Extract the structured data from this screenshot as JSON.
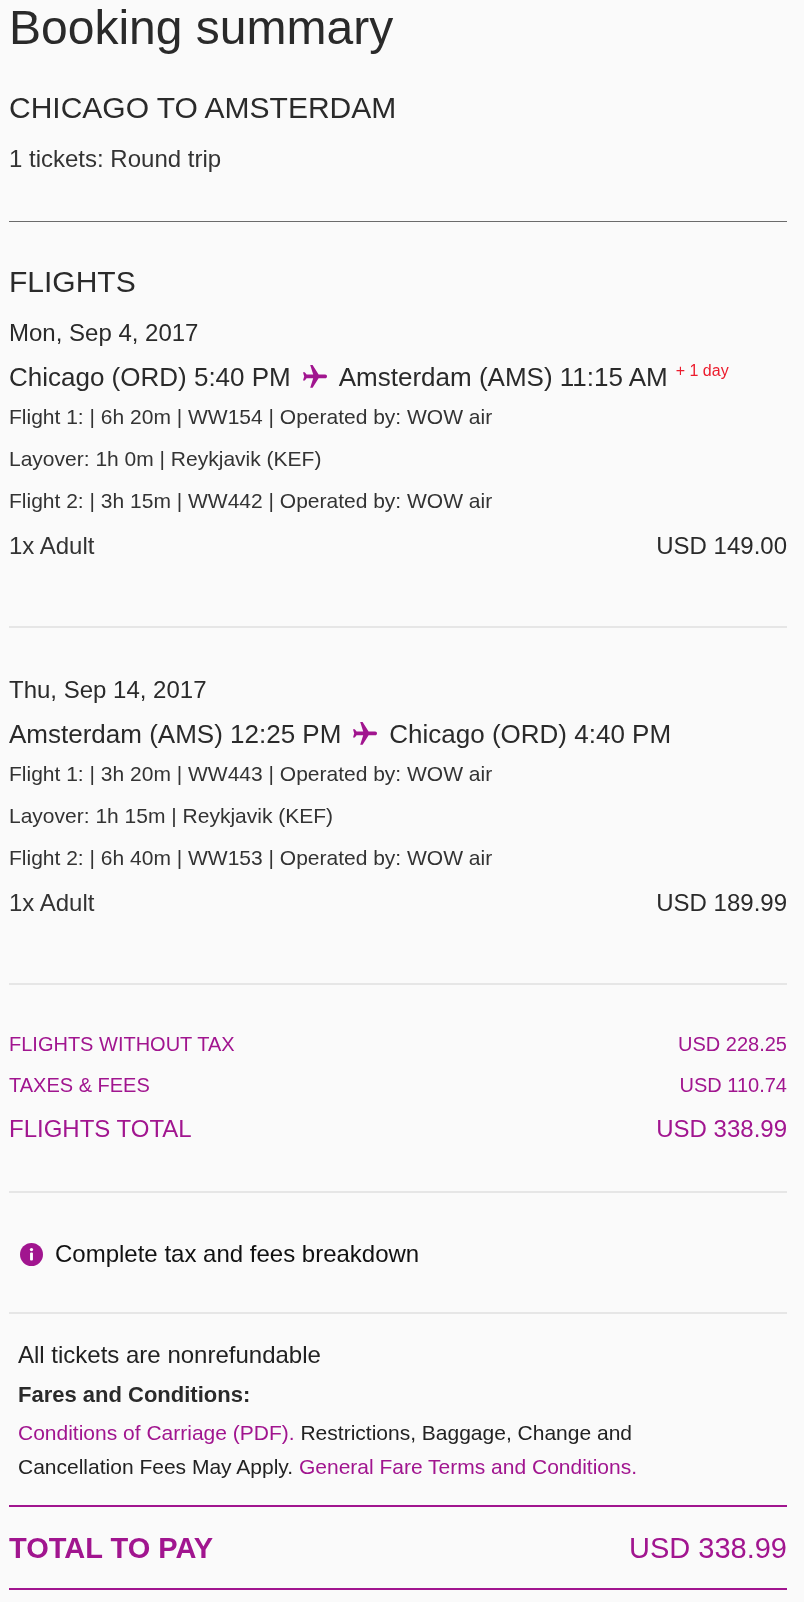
{
  "title": "Booking summary",
  "trip": {
    "heading": "CHICAGO TO AMSTERDAM",
    "tickets": "1 tickets: Round trip"
  },
  "flights": {
    "heading": "FLIGHTS",
    "legs": [
      {
        "date": "Mon, Sep 4, 2017",
        "from": "Chicago (ORD) 5:40 PM",
        "to": "Amsterdam (AMS) 11:15 AM",
        "day_offset": "+ 1 day",
        "details": [
          "Flight 1: | 6h 20m | WW154 | Operated by: WOW air",
          "Layover: 1h 0m | Reykjavik (KEF)",
          "Flight 2: | 3h 15m | WW442 | Operated by: WOW air"
        ],
        "passenger": "1x Adult",
        "price": "USD 149.00"
      },
      {
        "date": "Thu, Sep 14, 2017",
        "from": "Amsterdam (AMS) 12:25 PM",
        "to": "Chicago (ORD) 4:40 PM",
        "details": [
          "Flight 1: | 3h 20m | WW443 | Operated by: WOW air",
          "Layover: 1h 15m | Reykjavik (KEF)",
          "Flight 2: | 6h 40m | WW153 | Operated by: WOW air"
        ],
        "passenger": "1x Adult",
        "price": "USD 189.99"
      }
    ]
  },
  "totals": [
    {
      "kind": "subtotal",
      "label": "FLIGHTS WITHOUT TAX",
      "amount": "USD 228.25"
    },
    {
      "kind": "subtotal",
      "label": "TAXES & FEES",
      "amount": "USD 110.74"
    },
    {
      "kind": "total",
      "label": "FLIGHTS TOTAL",
      "amount": "USD 338.99"
    }
  ],
  "breakdown_link": "Complete tax and fees breakdown",
  "conditions": {
    "notice": "All tickets are nonrefundable",
    "heading": "Fares and Conditions:",
    "parts": [
      {
        "kind": "link",
        "text": "Conditions of Carriage (PDF)."
      },
      {
        "kind": "text",
        "text": "Restrictions, Baggage, Change and Cancellation Fees May Apply."
      },
      {
        "kind": "link",
        "text": "General Fare Terms and Conditions."
      }
    ]
  },
  "total_to_pay": {
    "label": "TOTAL TO PAY",
    "amount": "USD 338.99"
  }
}
